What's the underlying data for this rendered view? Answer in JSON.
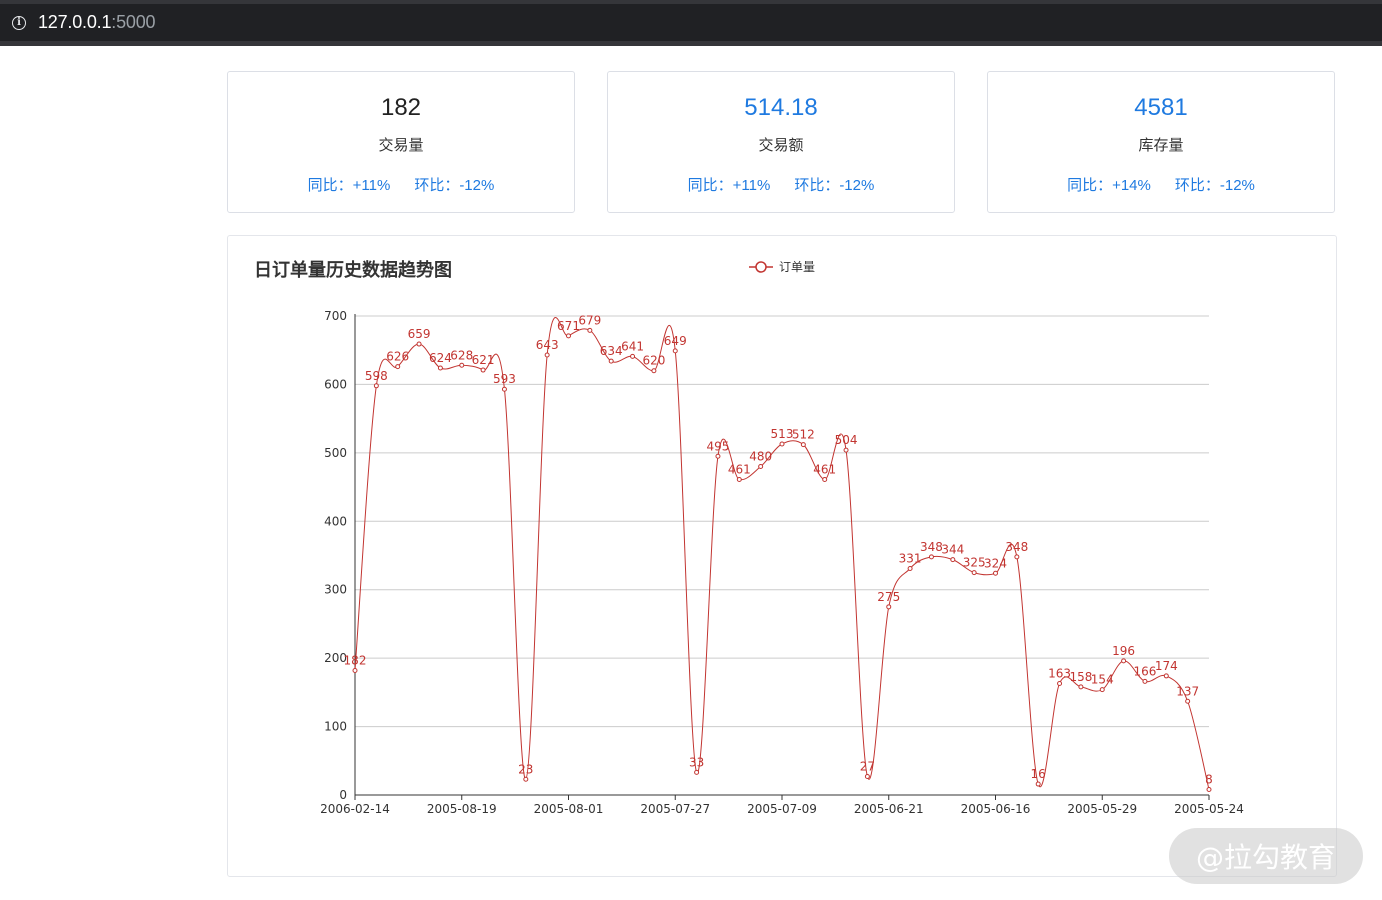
{
  "browser": {
    "url_host": "127.0.0.1",
    "url_port": ":5000"
  },
  "cards": [
    {
      "value": "182",
      "label": "交易量",
      "yoy": "同比：+11%",
      "mom": "环比：-12%",
      "value_color": "#222222"
    },
    {
      "value": "514.18",
      "label": "交易额",
      "yoy": "同比：+11%",
      "mom": "环比：-12%",
      "value_color": "#1f7ae0"
    },
    {
      "value": "4581",
      "label": "库存量",
      "yoy": "同比：+14%",
      "mom": "环比：-12%",
      "value_color": "#1f7ae0"
    }
  ],
  "watermark": "@拉勾教育",
  "chart_data": {
    "type": "line",
    "smooth": true,
    "title": "日订单量历史数据趋势图",
    "legend": "top-center",
    "grid": true,
    "color": "#c23531",
    "ylim": [
      0,
      700
    ],
    "yticks": [
      0,
      100,
      200,
      300,
      400,
      500,
      600,
      700
    ],
    "xtick_labels": [
      "2006-02-14",
      "2005-08-19",
      "2005-08-01",
      "2005-07-27",
      "2005-07-09",
      "2005-06-21",
      "2005-06-16",
      "2005-05-29",
      "2005-05-24"
    ],
    "xtick_every": 5,
    "series": [
      {
        "name": "订单量",
        "values": [
          182,
          598,
          626,
          659,
          624,
          628,
          621,
          593,
          23,
          643,
          671,
          679,
          634,
          641,
          620,
          649,
          33,
          495,
          461,
          480,
          513,
          512,
          461,
          504,
          27,
          275,
          331,
          348,
          344,
          325,
          324,
          348,
          16,
          163,
          158,
          154,
          196,
          166,
          174,
          137,
          8
        ]
      }
    ]
  }
}
